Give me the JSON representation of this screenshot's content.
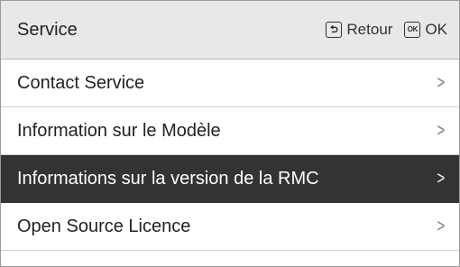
{
  "header": {
    "title": "Service",
    "back_label": "Retour",
    "ok_icon_text": "OK",
    "ok_label": "OK"
  },
  "menu": {
    "chevron": ">",
    "selected_index": 2,
    "items": [
      {
        "label": "Contact Service"
      },
      {
        "label": "Information sur le Modèle"
      },
      {
        "label": "Informations sur la version de la RMC"
      },
      {
        "label": "Open Source Licence"
      }
    ]
  },
  "icons": {
    "back": "back-arrow-icon",
    "ok": "ok-key-icon",
    "item_arrow": "chevron-right-icon"
  }
}
